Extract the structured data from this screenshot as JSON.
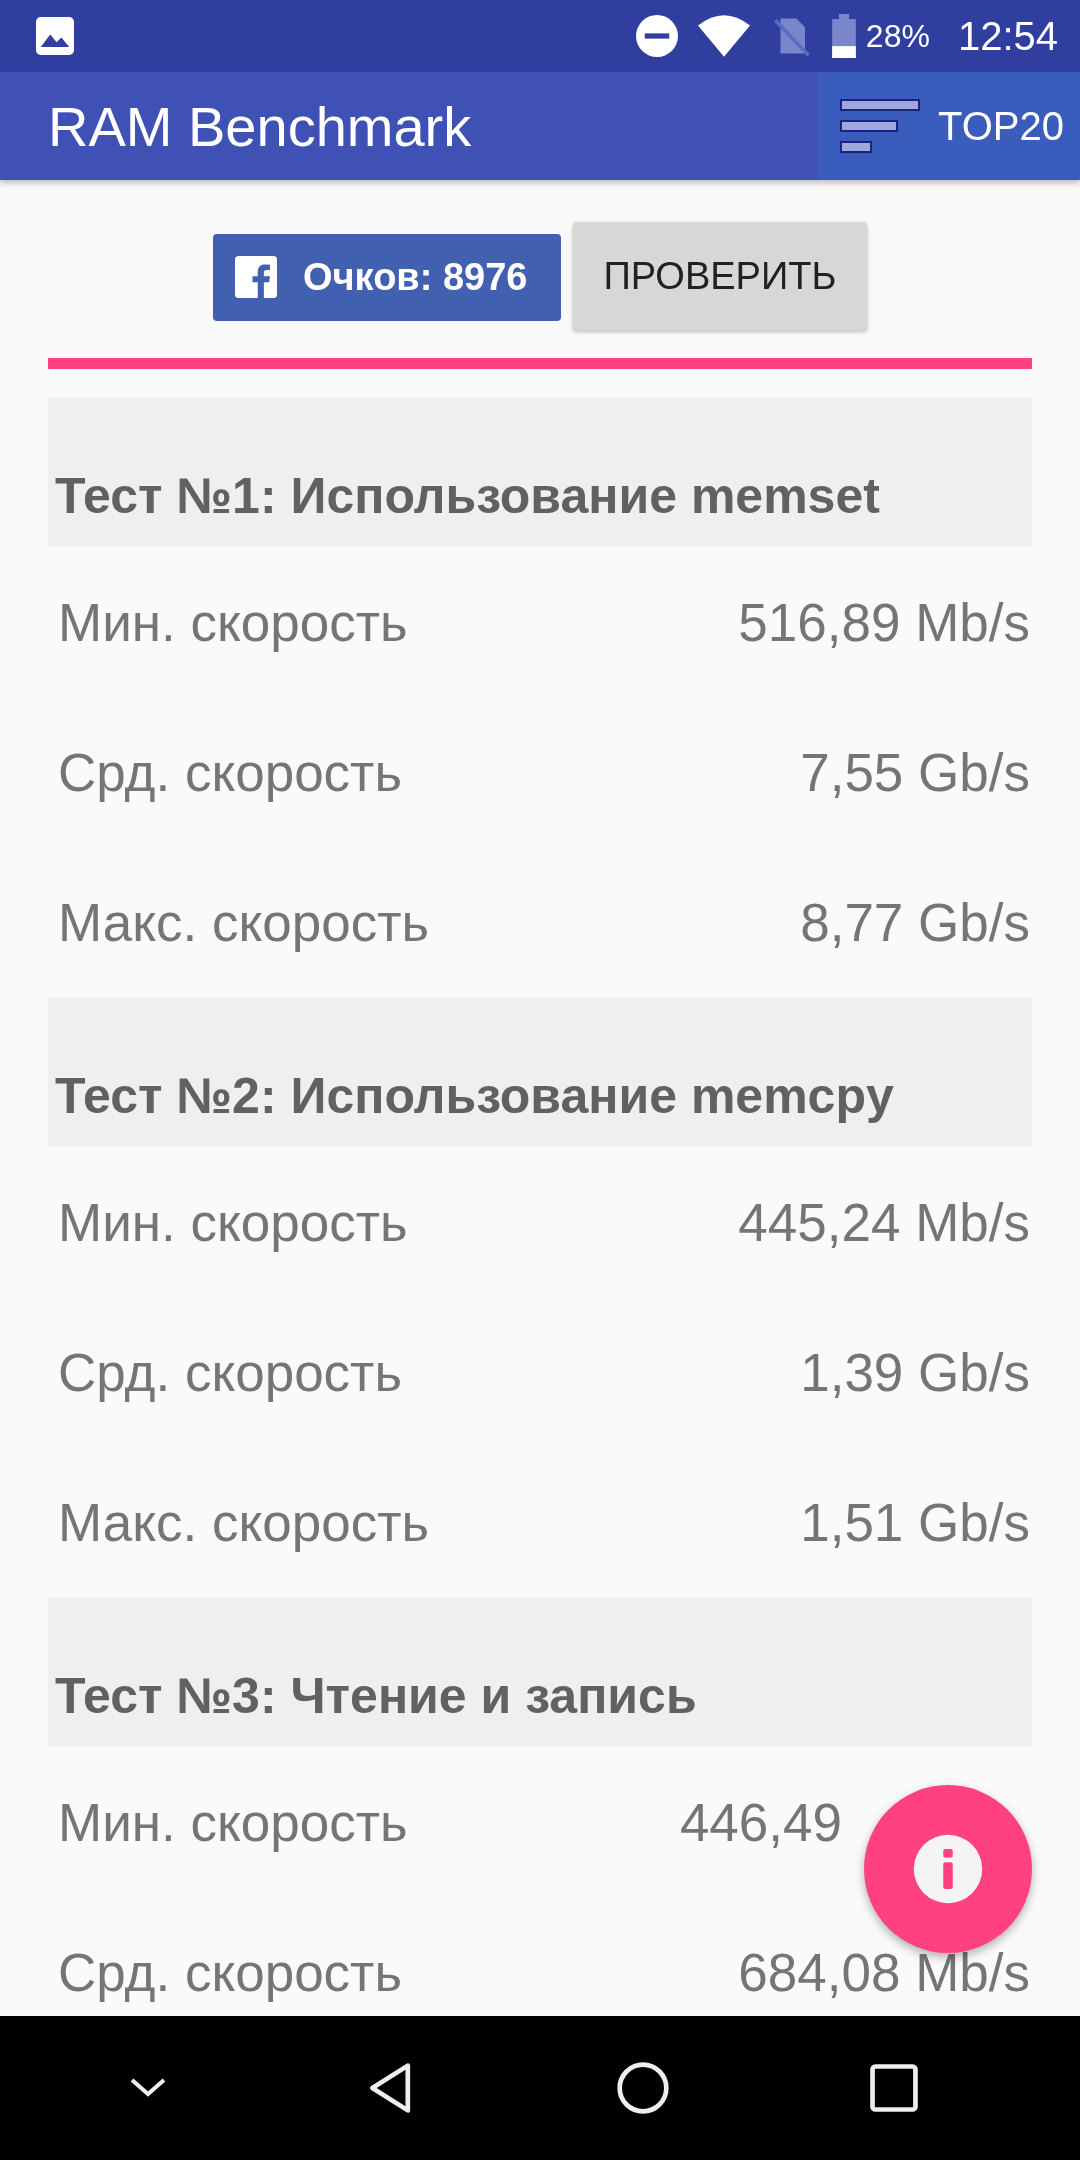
{
  "status_bar": {
    "battery": "28%",
    "time": "12:54"
  },
  "app_bar": {
    "title": "RAM Benchmark",
    "action": "TOP20"
  },
  "score_button": {
    "label": "Очков: 8976"
  },
  "check_button": {
    "label": "ПРОВЕРИТЬ"
  },
  "tests": [
    {
      "title": "Тест №1: Использование memset",
      "rows": [
        {
          "label": "Мин. скорость",
          "value": "516,89 Mb/s",
          "under_fab": false
        },
        {
          "label": "Срд. скорость",
          "value": "7,55 Gb/s",
          "under_fab": false
        },
        {
          "label": "Макс. скорость",
          "value": "8,77 Gb/s",
          "under_fab": false
        }
      ]
    },
    {
      "title": "Тест №2: Использование memcpy",
      "rows": [
        {
          "label": "Мин. скорость",
          "value": "445,24 Mb/s",
          "under_fab": false
        },
        {
          "label": "Срд. скорость",
          "value": "1,39 Gb/s",
          "under_fab": false
        },
        {
          "label": "Макс. скорость",
          "value": "1,51 Gb/s",
          "under_fab": false
        }
      ]
    },
    {
      "title": "Тест №3: Чтение и запись",
      "rows": [
        {
          "label": "Мин. скорость",
          "value": "446,49",
          "under_fab": true
        },
        {
          "label": "Срд. скорость",
          "value": "684,08 Mb/s",
          "under_fab": false
        }
      ]
    }
  ]
}
